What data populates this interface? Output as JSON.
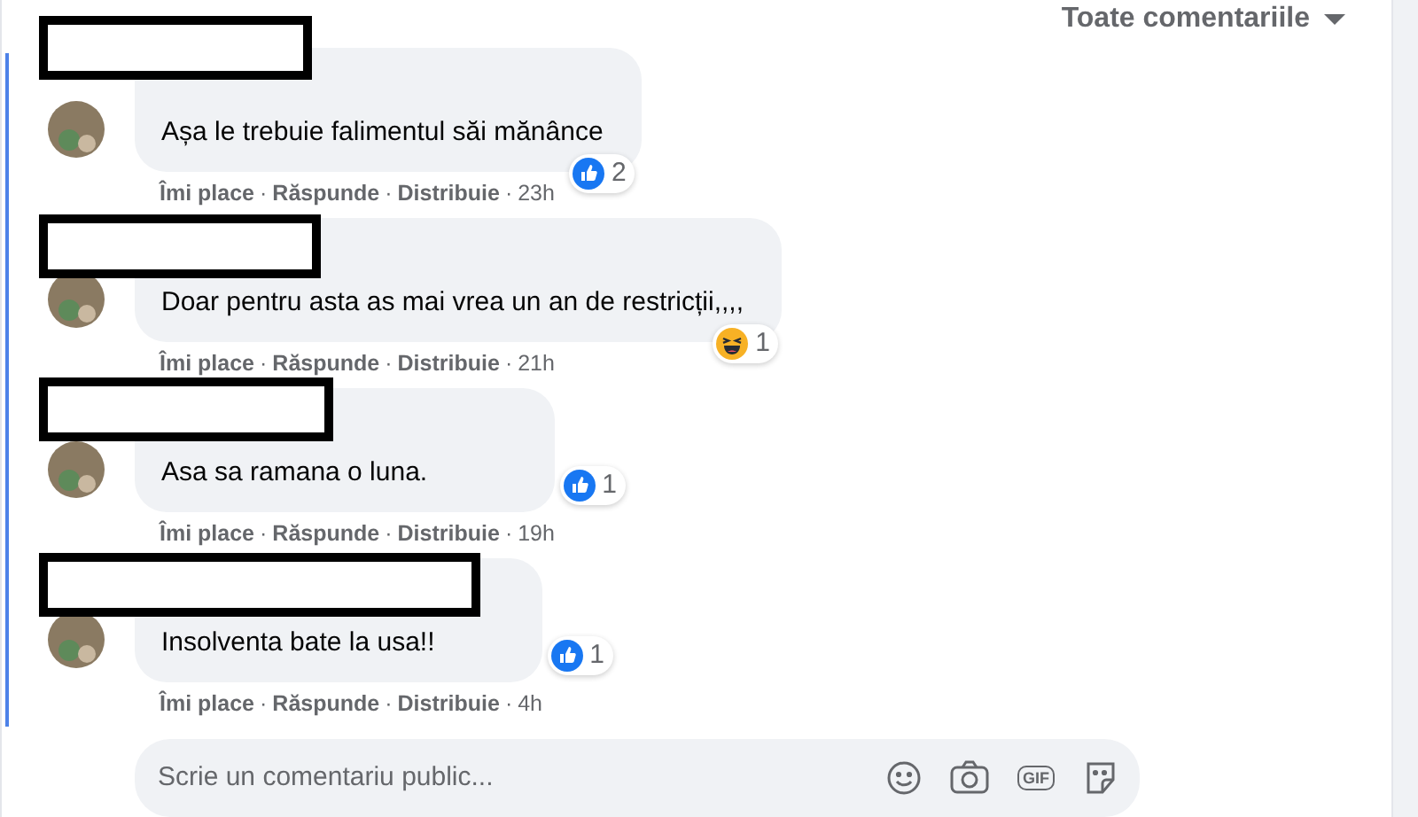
{
  "sort_menu": {
    "label": "Toate comentariile"
  },
  "comments": [
    {
      "text": "Așa le trebuie falimentul săi mănânce",
      "actions": [
        {
          "kind": "link",
          "text": "Îmi place"
        },
        {
          "kind": "separator",
          "text": "·"
        },
        {
          "kind": "link",
          "text": "Răspunde"
        },
        {
          "kind": "separator",
          "text": "·"
        },
        {
          "kind": "link",
          "text": "Distribuie"
        },
        {
          "kind": "separator",
          "text": "·"
        },
        {
          "kind": "time",
          "text": "23h"
        }
      ],
      "reaction": {
        "kind": "like",
        "count": "2"
      }
    },
    {
      "text": "Doar pentru asta as mai vrea un an de restricții,,,,",
      "actions": [
        {
          "kind": "link",
          "text": "Îmi place"
        },
        {
          "kind": "separator",
          "text": "·"
        },
        {
          "kind": "link",
          "text": "Răspunde"
        },
        {
          "kind": "separator",
          "text": "·"
        },
        {
          "kind": "link",
          "text": "Distribuie"
        },
        {
          "kind": "separator",
          "text": "·"
        },
        {
          "kind": "time",
          "text": "21h"
        }
      ],
      "reaction": {
        "kind": "haha",
        "count": "1"
      }
    },
    {
      "text": "Asa sa ramana o luna.",
      "actions": [
        {
          "kind": "link",
          "text": "Îmi place"
        },
        {
          "kind": "separator",
          "text": "·"
        },
        {
          "kind": "link",
          "text": "Răspunde"
        },
        {
          "kind": "separator",
          "text": "·"
        },
        {
          "kind": "link",
          "text": "Distribuie"
        },
        {
          "kind": "separator",
          "text": "·"
        },
        {
          "kind": "time",
          "text": "19h"
        }
      ],
      "reaction": {
        "kind": "like",
        "count": "1"
      }
    },
    {
      "text": "Insolventa bate la usa!!",
      "actions": [
        {
          "kind": "link",
          "text": "Îmi place"
        },
        {
          "kind": "separator",
          "text": "·"
        },
        {
          "kind": "link",
          "text": "Răspunde"
        },
        {
          "kind": "separator",
          "text": "·"
        },
        {
          "kind": "link",
          "text": "Distribuie"
        },
        {
          "kind": "separator",
          "text": "·"
        },
        {
          "kind": "time",
          "text": "4h"
        }
      ],
      "reaction": {
        "kind": "like",
        "count": "1"
      }
    }
  ],
  "composer": {
    "placeholder": "Scrie un comentariu public...",
    "gif_label": "GIF"
  }
}
